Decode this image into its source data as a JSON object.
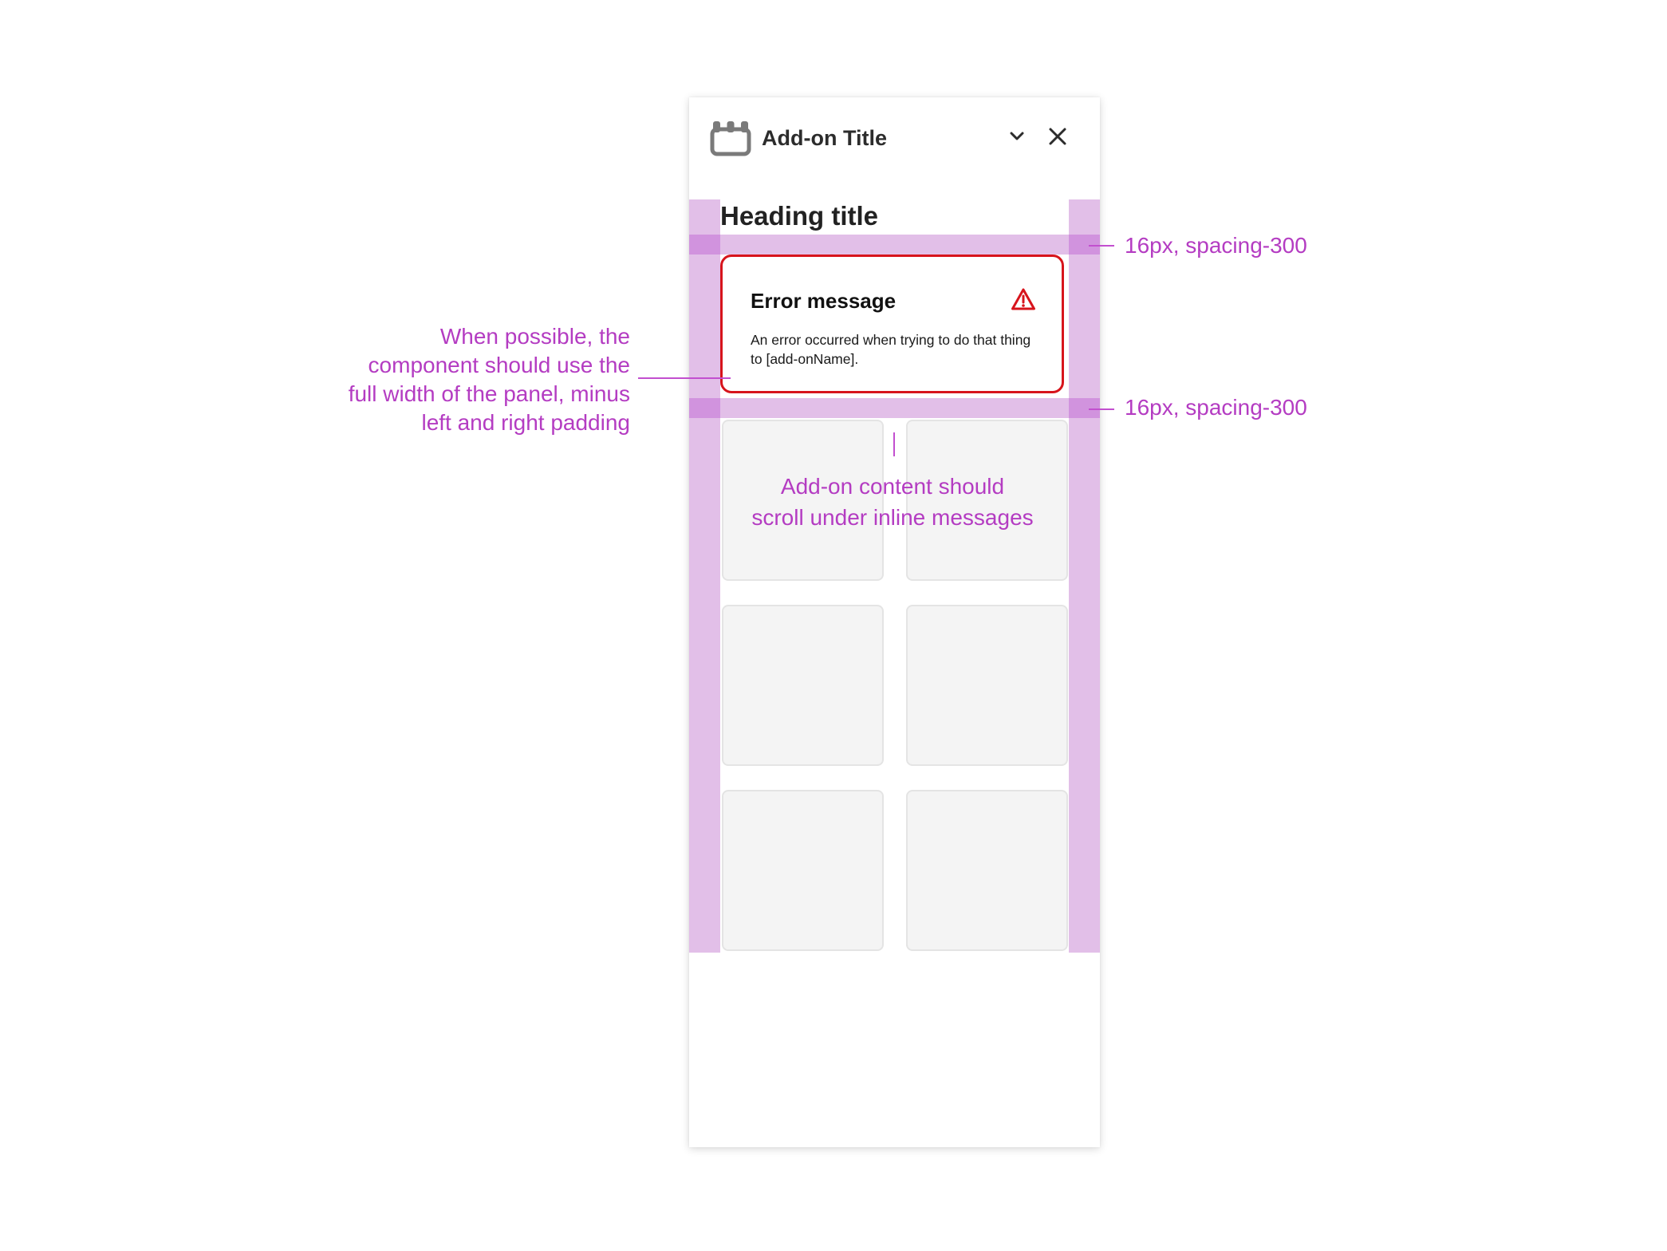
{
  "panel": {
    "title": "Add-on Title",
    "icon": "add-on-icon",
    "collapse_icon": "chevron-down-icon",
    "close_icon": "close-icon"
  },
  "content": {
    "heading": "Heading title",
    "tiles_count": 6
  },
  "error_message": {
    "title": "Error message",
    "body": "An error occurred when trying to do that thing to [add-onName].",
    "icon": "alert-triangle-icon",
    "color": "#d7141c"
  },
  "annotations": {
    "full_width_lines": [
      "When possible, the",
      "component should use the",
      "full width of the panel, minus",
      "left and right padding"
    ],
    "scroll_lines": [
      "Add-on content should",
      "scroll under inline messages"
    ],
    "spacing_top": "16px, spacing-300",
    "spacing_bottom": "16px, spacing-300",
    "color": "#b43cc2"
  },
  "colors": {
    "padding_overlay": "#e2bfe8",
    "padding_overlay_overlap": "#d193de",
    "tile_fill": "#f4f4f4",
    "tile_border": "#e4e4e4"
  }
}
